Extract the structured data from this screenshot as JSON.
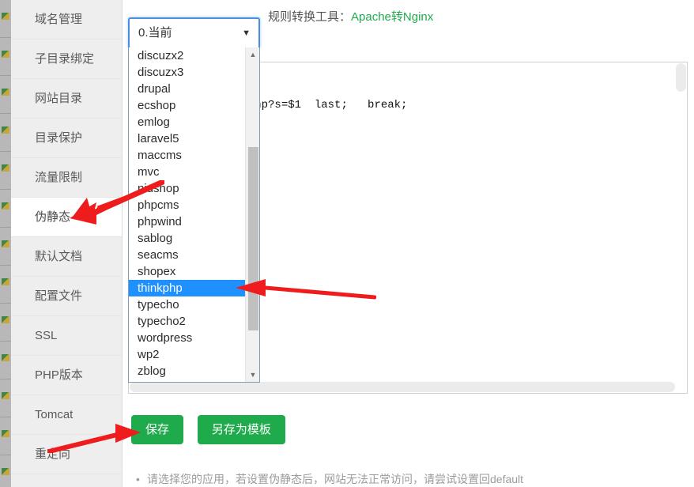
{
  "colors": {
    "accent_green": "#1faa4b",
    "link_green": "#20ab4d",
    "select_border_blue": "#4a90e2",
    "highlight_blue": "#1e90ff",
    "sidebar_bg": "#eeeeee",
    "annotation_red": "#ee1c1c"
  },
  "sidebar": {
    "items": [
      {
        "label": "域名管理",
        "active": false
      },
      {
        "label": "子目录绑定",
        "active": false
      },
      {
        "label": "网站目录",
        "active": false
      },
      {
        "label": "目录保护",
        "active": false
      },
      {
        "label": "流量限制",
        "active": false
      },
      {
        "label": "伪静态",
        "active": true
      },
      {
        "label": "默认文档",
        "active": false
      },
      {
        "label": "配置文件",
        "active": false
      },
      {
        "label": "SSL",
        "active": false
      },
      {
        "label": "PHP版本",
        "active": false
      },
      {
        "label": "Tomcat",
        "active": false
      },
      {
        "label": "重定向",
        "active": false
      }
    ]
  },
  "app_select": {
    "value": "0.当前",
    "caret_icon": "chevron-down-icon",
    "options": [
      "discuzx2",
      "discuzx3",
      "drupal",
      "ecshop",
      "emlog",
      "laravel5",
      "maccms",
      "mvc",
      "niushop",
      "phpcms",
      "phpwind",
      "sablog",
      "seacms",
      "shopex",
      "thinkphp",
      "typecho",
      "typecho2",
      "wordpress",
      "wp2",
      "zblog"
    ],
    "selected_option": "thinkphp",
    "scroll_up_icon": "triangle-up-icon",
    "scroll_down_icon": "triangle-down-icon"
  },
  "tool_row": {
    "label": "规则转换工具：",
    "link_text": "Apache转Nginx"
  },
  "code_editor": {
    "content": "equest_filename) {\n  ^(.*)$  /index.php?s=$1  last;   break;"
  },
  "buttons": {
    "save": "保存",
    "save_as_template": "另存为模板"
  },
  "hint": {
    "bullet": "•",
    "text": "请选择您的应用，若设置伪静态后，网站无法正常访问，请尝试设置回default"
  }
}
